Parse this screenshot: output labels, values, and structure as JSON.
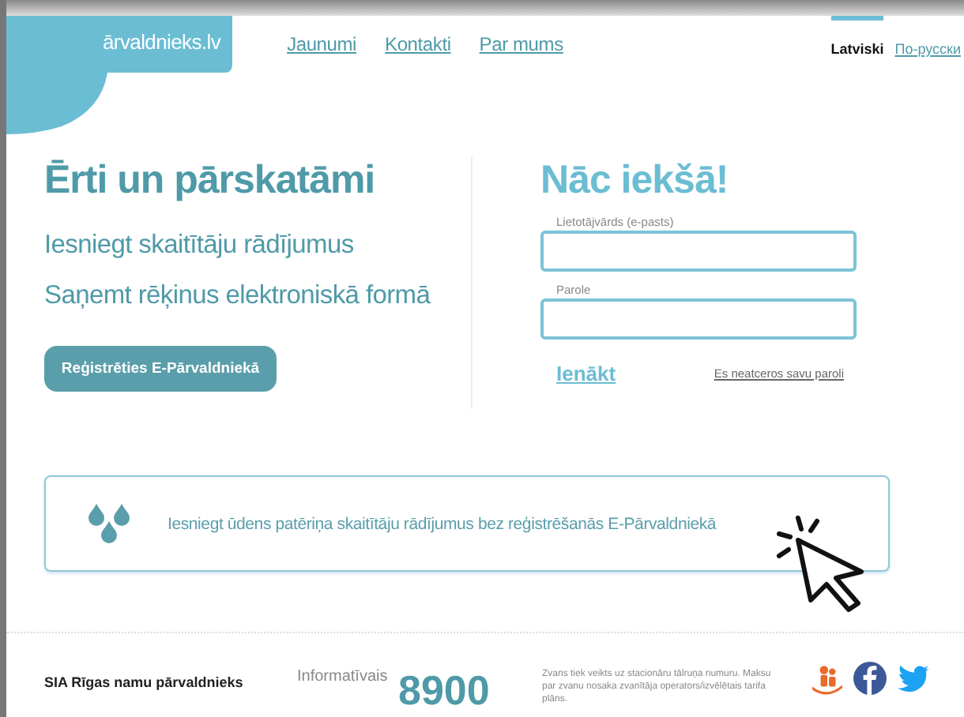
{
  "logo": {
    "text": "ārvaldnieks.lv"
  },
  "nav": [
    {
      "label": "Jaunumi"
    },
    {
      "label": "Kontakti"
    },
    {
      "label": "Par mums"
    }
  ],
  "languages": [
    {
      "label": "Latviski",
      "selected": true
    },
    {
      "label": "По-русски",
      "selected": false
    }
  ],
  "hero": {
    "title": "Ērti un pārskatāmi",
    "lines": [
      "Iesniegt skaitītāju rādījumus",
      "Saņemt rēķinus elektroniskā formā"
    ],
    "button": "Reģistrēties E-Pārvaldniekā"
  },
  "login": {
    "title": "Nāc iekšā!",
    "username_label": "Lietotājvārds (e-pasts)",
    "password_label": "Parole",
    "submit": "Ienākt",
    "forgot": "Es neatceros savu paroli"
  },
  "banner": {
    "text": "Iesniegt ūdens patēriņa skaitītāju rādījumus bez reģistrēšanās E-Pārvaldniekā"
  },
  "footer": {
    "company": "SIA Rīgas namu pārvaldnieks",
    "phone_label": "Informatīvais",
    "phone": "8900",
    "phone_note": "Zvans tiek veikts uz stacionāru tālruņa numuru. Maksu par zvanu nosaka zvanītāja operators/izvēlētais tarifa plāns."
  }
}
